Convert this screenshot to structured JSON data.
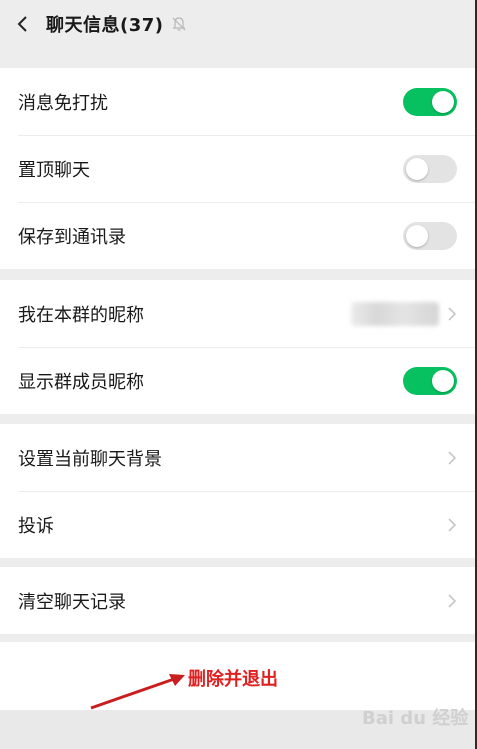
{
  "header": {
    "title": "聊天信息(37)",
    "back_icon": "chevron-left-icon",
    "mute_icon": "bell-off-icon"
  },
  "group1": [
    {
      "label": "消息免打扰",
      "toggle": "on"
    },
    {
      "label": "置顶聊天",
      "toggle": "off"
    },
    {
      "label": "保存到通讯录",
      "toggle": "off"
    }
  ],
  "group2": [
    {
      "label": "我在本群的昵称",
      "value": ""
    },
    {
      "label": "显示群成员昵称",
      "toggle": "on"
    }
  ],
  "group3": [
    {
      "label": "设置当前聊天背景"
    },
    {
      "label": "投诉"
    }
  ],
  "group4": [
    {
      "label": "清空聊天记录"
    }
  ],
  "actions": {
    "delete_exit": "删除并退出"
  },
  "watermark": "Bai du 经验",
  "colors": {
    "toggle_on": "#07c160",
    "toggle_off": "#e3e3e3",
    "danger": "#e02020",
    "annotation_arrow": "#c81e1e"
  }
}
